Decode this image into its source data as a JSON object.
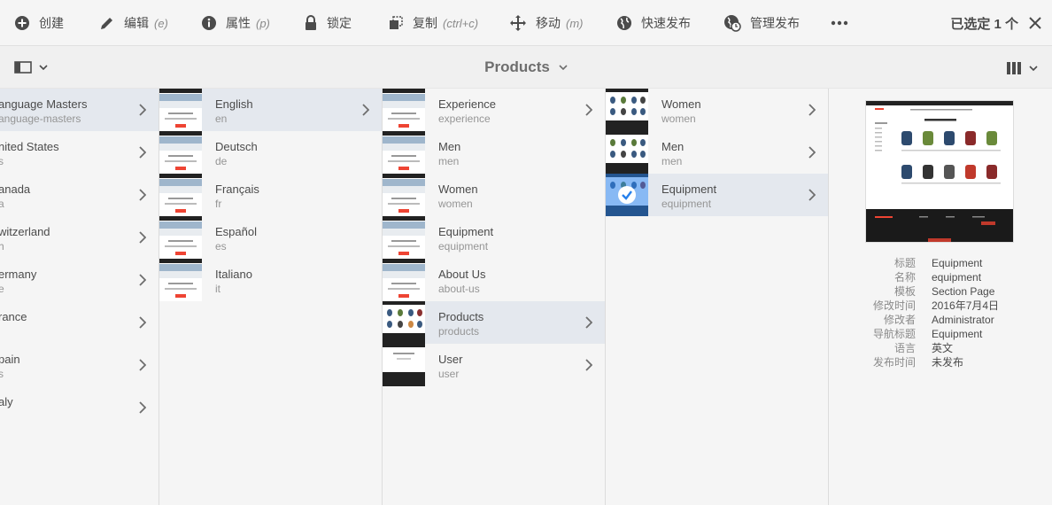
{
  "toolbar": {
    "create": "创建",
    "edit": "编辑",
    "edit_key": "(e)",
    "properties": "属性",
    "properties_key": "(p)",
    "lock": "锁定",
    "copy": "复制",
    "copy_key": "(ctrl+c)",
    "move": "移动",
    "move_key": "(m)",
    "quick_publish": "快速发布",
    "manage_publication": "管理发布",
    "selected": "已选定 1 个"
  },
  "header": {
    "title": "Products"
  },
  "columns": [
    {
      "items": [
        {
          "title": "anguage Masters",
          "sub": "anguage-masters",
          "active": true
        },
        {
          "title": "nited States",
          "sub": "s"
        },
        {
          "title": "anada",
          "sub": "a"
        },
        {
          "title": "witzerland",
          "sub": "h"
        },
        {
          "title": "ermany",
          "sub": "e"
        },
        {
          "title": "rance",
          "sub": ""
        },
        {
          "title": "pain",
          "sub": "s"
        },
        {
          "title": "aly",
          "sub": ""
        }
      ]
    },
    {
      "items": [
        {
          "title": "English",
          "sub": "en",
          "active": true
        },
        {
          "title": "Deutsch",
          "sub": "de"
        },
        {
          "title": "Français",
          "sub": "fr"
        },
        {
          "title": "Español",
          "sub": "es"
        },
        {
          "title": "Italiano",
          "sub": "it"
        }
      ]
    },
    {
      "items": [
        {
          "title": "Experience",
          "sub": "experience"
        },
        {
          "title": "Men",
          "sub": "men"
        },
        {
          "title": "Women",
          "sub": "women"
        },
        {
          "title": "Equipment",
          "sub": "equipment"
        },
        {
          "title": "About Us",
          "sub": "about-us"
        },
        {
          "title": "Products",
          "sub": "products",
          "active": true
        },
        {
          "title": "User",
          "sub": "user"
        }
      ]
    },
    {
      "items": [
        {
          "title": "Women",
          "sub": "women"
        },
        {
          "title": "Men",
          "sub": "men"
        },
        {
          "title": "Equipment",
          "sub": "equipment",
          "active": true
        }
      ]
    }
  ],
  "details": [
    {
      "k": "标题",
      "v": "Equipment"
    },
    {
      "k": "名称",
      "v": "equipment"
    },
    {
      "k": "模板",
      "v": "Section Page"
    },
    {
      "k": "修改时间",
      "v": "2016年7月4日"
    },
    {
      "k": "修改者",
      "v": "Administrator"
    },
    {
      "k": "导航标题",
      "v": "Equipment"
    },
    {
      "k": "语言",
      "v": "英文"
    },
    {
      "k": "发布时间",
      "v": "未发布"
    }
  ],
  "colors": {
    "accent": "#2680eb",
    "active_row": "#e4e8ee",
    "text": "#4b4b4b"
  }
}
